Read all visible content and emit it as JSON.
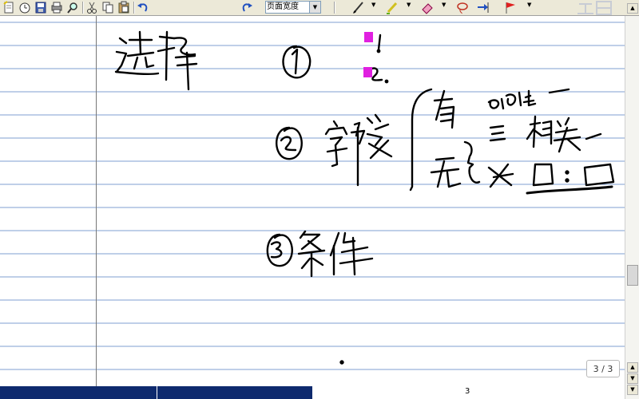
{
  "toolbar": {
    "zoom_value": "页面宽度",
    "buttons": [
      "new-note-icon",
      "timer-icon",
      "save-icon",
      "print-icon",
      "find-icon",
      "cut-icon",
      "copy-icon",
      "paste-icon",
      "undo-icon",
      "redo-icon",
      "pen-icon",
      "highlighter-icon",
      "eraser-icon",
      "lasso-icon",
      "insert-space-icon",
      "flag-icon"
    ]
  },
  "colors": {
    "ink": "#000000",
    "bullet": "#e020e0",
    "toolbar_bg": "#ece9d8",
    "bottom_bar": "#0e2a6e"
  },
  "status": {
    "page_counter": "3 / 3",
    "page_number": "3"
  }
}
